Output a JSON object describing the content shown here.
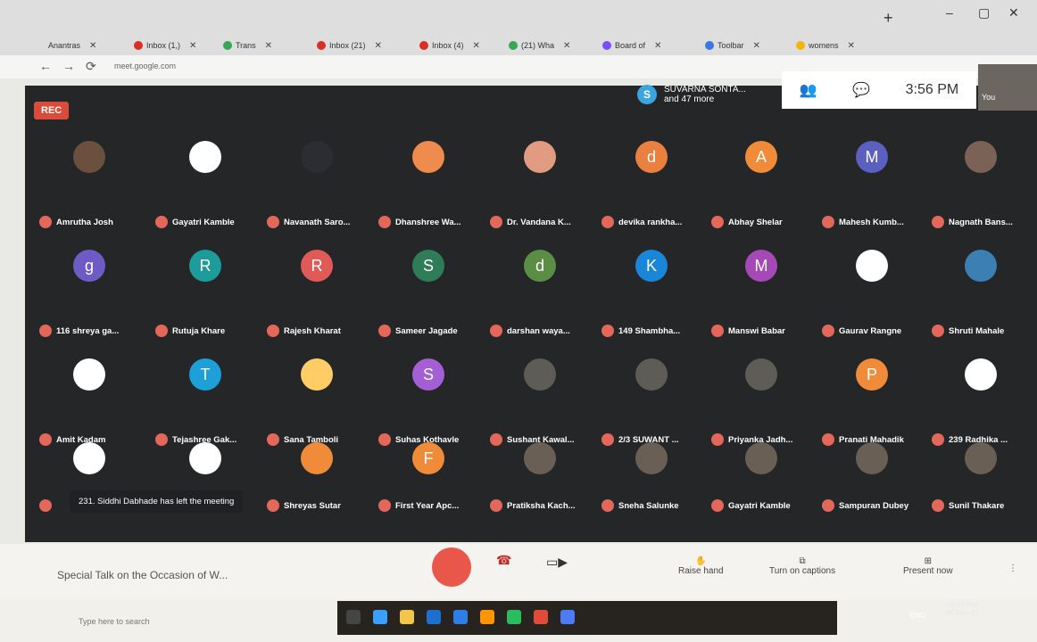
{
  "browser": {
    "tabs": [
      {
        "label": "Anantras",
        "color": "#3b78e7"
      },
      {
        "label": "Inbox (1,)",
        "color": "#d93025"
      },
      {
        "label": "Trans",
        "color": "#34a853"
      },
      {
        "label": "Inbox (21)",
        "color": "#d93025"
      },
      {
        "label": "Inbox (4)",
        "color": "#d93025"
      },
      {
        "label": "(21) Wha",
        "color": "#34a853"
      },
      {
        "label": "Board of",
        "color": "#7c4dff"
      },
      {
        "label": "Toolbar",
        "color": "#3b78e7"
      },
      {
        "label": "womens",
        "color": "#f2b705"
      }
    ],
    "url": "meet.google.com"
  },
  "meet": {
    "rec_label": "REC",
    "presenter_name": "SUVARNA SONTA...",
    "presenter_extra": "and 47 more",
    "time": "3:56 PM",
    "self_label": "You",
    "toast": "231. Siddhi Dabhade has left the meeting",
    "participants": [
      {
        "name": "Amrutha Josh",
        "initial": "",
        "color": "#6b4f3f"
      },
      {
        "name": "Gayatri Kamble",
        "initial": "",
        "color": "#ffffff"
      },
      {
        "name": "Navanath Saro...",
        "initial": "",
        "color": "#2b2d33"
      },
      {
        "name": "Dhanshree Wa...",
        "initial": "",
        "color": "#f08b4e"
      },
      {
        "name": "Dr. Vandana K...",
        "initial": "",
        "color": "#e09b80"
      },
      {
        "name": "devika rankha...",
        "initial": "d",
        "color": "#e9803f"
      },
      {
        "name": "Abhay Shelar",
        "initial": "A",
        "color": "#f08b3a"
      },
      {
        "name": "Mahesh Kumb...",
        "initial": "M",
        "color": "#5b5fbf"
      },
      {
        "name": "Nagnath Bans...",
        "initial": "",
        "color": "#7a6356"
      },
      {
        "name": "116 shreya ga...",
        "initial": "g",
        "color": "#6e5bc6"
      },
      {
        "name": "Rutuja Khare",
        "initial": "R",
        "color": "#1d9c9b"
      },
      {
        "name": "Rajesh Kharat",
        "initial": "R",
        "color": "#e05a57"
      },
      {
        "name": "Sameer Jagade",
        "initial": "S",
        "color": "#2f7c58"
      },
      {
        "name": "darshan waya...",
        "initial": "d",
        "color": "#5b8d45"
      },
      {
        "name": "149 Shambha...",
        "initial": "K",
        "color": "#1a86d8"
      },
      {
        "name": "Manswi Babar",
        "initial": "M",
        "color": "#a648b8"
      },
      {
        "name": "Gaurav Rangne",
        "initial": "",
        "color": "#ffffff"
      },
      {
        "name": "Shruti Mahale",
        "initial": "",
        "color": "#3b7fb3"
      },
      {
        "name": "Amit Kadam",
        "initial": "",
        "color": "#ffffff"
      },
      {
        "name": "Tejashree Gak...",
        "initial": "T",
        "color": "#1d9fd8"
      },
      {
        "name": "Sana Tamboli",
        "initial": "",
        "color": "#ffcc66"
      },
      {
        "name": "Suhas Kothavle",
        "initial": "S",
        "color": "#a35fd3"
      },
      {
        "name": "Sushant Kawal...",
        "initial": "",
        "color": "#5e5c56"
      },
      {
        "name": "2/3 SUWANT ...",
        "initial": "",
        "color": "#5e5c56"
      },
      {
        "name": "Priyanka Jadh...",
        "initial": "",
        "color": "#5e5c56"
      },
      {
        "name": "Pranati Mahadik",
        "initial": "P",
        "color": "#f08b3a"
      },
      {
        "name": "239 Radhika ...",
        "initial": "",
        "color": "#ffffff"
      },
      {
        "name": "",
        "initial": "",
        "color": "#ffffff"
      },
      {
        "name": "",
        "initial": "",
        "color": "#ffffff"
      },
      {
        "name": "Shreyas Sutar",
        "initial": "",
        "color": "#f08b3a"
      },
      {
        "name": "First Year Apc...",
        "initial": "F",
        "color": "#f08b3a"
      },
      {
        "name": "Pratiksha Kach...",
        "initial": "",
        "color": "#6a5f55"
      },
      {
        "name": "Sneha Salunke",
        "initial": "",
        "color": "#6a5f55"
      },
      {
        "name": "Gayatri Kamble",
        "initial": "",
        "color": "#6a5f55"
      },
      {
        "name": "Sampuran Dubey",
        "initial": "",
        "color": "#6a5f55"
      },
      {
        "name": "Sunil Thakare",
        "initial": "",
        "color": "#6a5f55"
      }
    ],
    "meeting_title": "Special Talk on the Occasion of W...",
    "controls": {
      "raise_hand": "Raise hand",
      "captions": "Turn on captions",
      "present": "Present now"
    }
  },
  "taskbar": {
    "search_placeholder": "Type here to search",
    "time": "03:56 PM",
    "date": "05-Mar-21",
    "lang": "ENG"
  }
}
